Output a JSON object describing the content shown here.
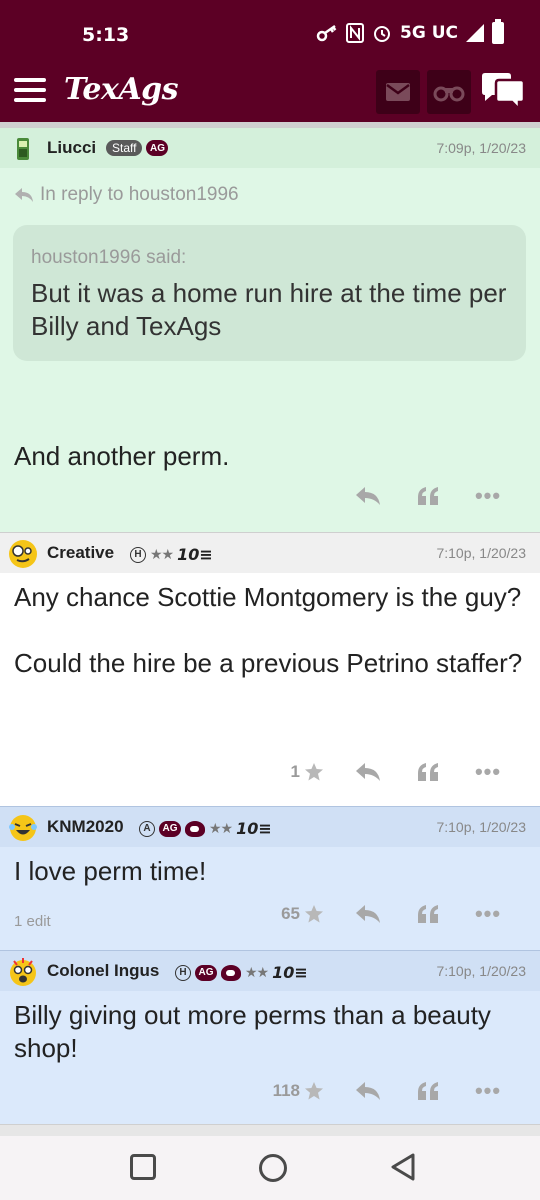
{
  "status_bar": {
    "time": "5:13",
    "network": "5G UC"
  },
  "app": {
    "logo": "TexAgs",
    "colors": {
      "brand": "#5c0025",
      "staff_post_bg": "#dff7e6",
      "highlight_post_bg": "#dbe9fb"
    }
  },
  "posts": [
    {
      "username": "Liucci",
      "badge_staff": "Staff",
      "badge_ag": "AG",
      "timestamp": "7:09p, 1/20/23",
      "in_reply_to": "In reply to houston1996",
      "quote_author": "houston1996 said:",
      "quote_text": "But it was a home run hire at the time per Billy and TexAgs",
      "body": "And another perm."
    },
    {
      "username": "Creative",
      "badge_h": "H",
      "stars": "★★",
      "tenbadge": "10≡",
      "timestamp": "7:10p, 1/20/23",
      "body_line1": "Any chance Scottie Montgomery is the guy?",
      "body_line2": "Could the hire be a previous Petrino staffer?",
      "star_count": "1"
    },
    {
      "username": "KNM2020",
      "badge_a": "A",
      "badge_ag": "AG",
      "stars": "★★",
      "tenbadge": "10≡",
      "timestamp": "7:10p, 1/20/23",
      "body": "I love perm time!",
      "edits": "1 edit",
      "star_count": "65"
    },
    {
      "username": "Colonel Ingus",
      "badge_h": "H",
      "badge_ag": "AG",
      "stars": "★★",
      "tenbadge": "10≡",
      "timestamp": "7:10p, 1/20/23",
      "body": "Billy giving out more perms than a beauty shop!",
      "star_count": "118"
    }
  ],
  "icons": {
    "reply": "reply-icon",
    "quote": "quote-icon",
    "more": "more-icon",
    "star": "star-icon"
  }
}
